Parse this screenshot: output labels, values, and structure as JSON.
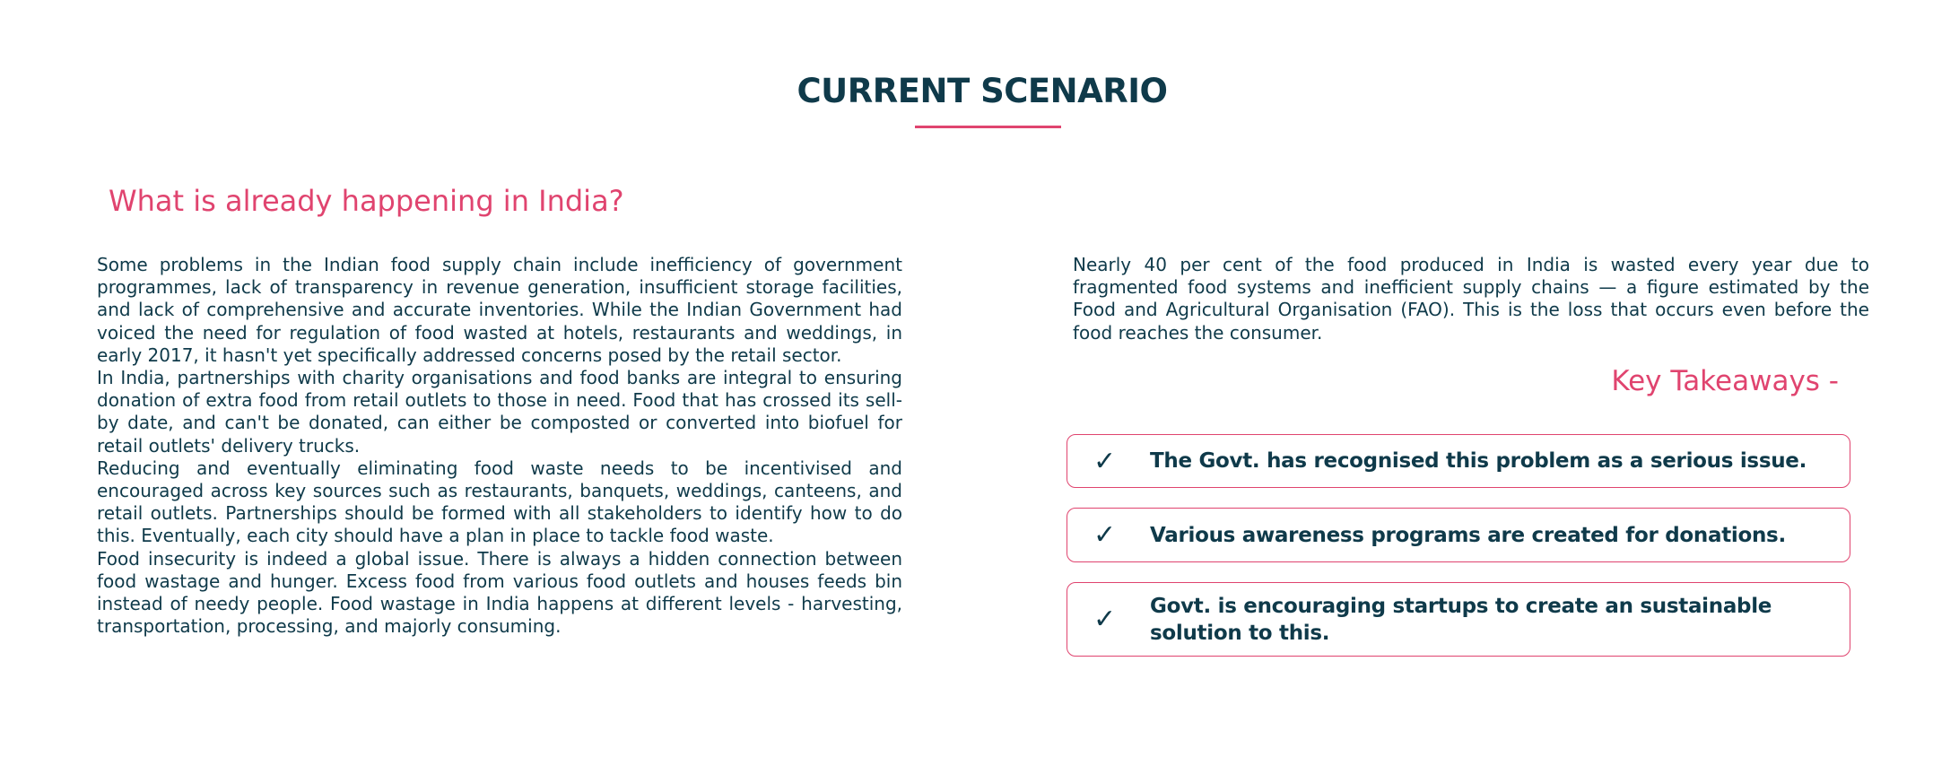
{
  "page": {
    "title": "CURRENT SCENARIO",
    "subheading": "What is already happening in India?",
    "accent_color": "#e0446f",
    "text_color": "#0f3a4a"
  },
  "left_column": {
    "paragraphs": [
      "Some problems in the Indian food supply chain include inefficiency of government programmes, lack of transparency in revenue generation, insufficient storage facilities, and lack of comprehensive and accurate inventories. While the Indian Government had voiced the need for regulation of food wasted at hotels, restaurants and weddings, in early 2017, it hasn't yet specifically addressed concerns posed by the retail sector.",
      "In India, partnerships with charity organisations and food banks are integral to ensuring donation of extra food from retail outlets to those in need. Food that has crossed its sell-by date, and can't be donated, can either be composted or converted into biofuel for retail outlets' delivery trucks.",
      "Reducing and eventually eliminating food waste needs to be incentivised and encouraged across key sources such as restaurants, banquets, weddings, canteens, and retail outlets. Partnerships should be formed with all stakeholders to identify how to do this. Eventually, each city should have a plan in place to tackle food waste.",
      "Food insecurity is indeed a global issue. There is always a hidden connection between food wastage and hunger. Excess food from various food outlets and houses feeds bin instead of needy people. Food wastage in India happens at different levels - harvesting, transportation, processing, and majorly consuming."
    ]
  },
  "right_column": {
    "paragraph": "Nearly 40 per cent of the food produced in India is wasted every year due to fragmented food systems and inefficient supply chains — a figure estimated by the Food and Agricultural Organisation (FAO). This is the loss that occurs even before the food reaches the consumer.",
    "takeaways_heading": "Key Takeaways -",
    "takeaways": [
      {
        "icon": "check-icon",
        "mark": "✓",
        "text": "The Govt. has recognised this problem as a serious issue."
      },
      {
        "icon": "check-icon",
        "mark": "✓",
        "text": "Various awareness programs are created for donations."
      },
      {
        "icon": "check-icon",
        "mark": "✓",
        "text": "Govt. is encouraging startups to create an sustainable solution to this."
      }
    ]
  }
}
